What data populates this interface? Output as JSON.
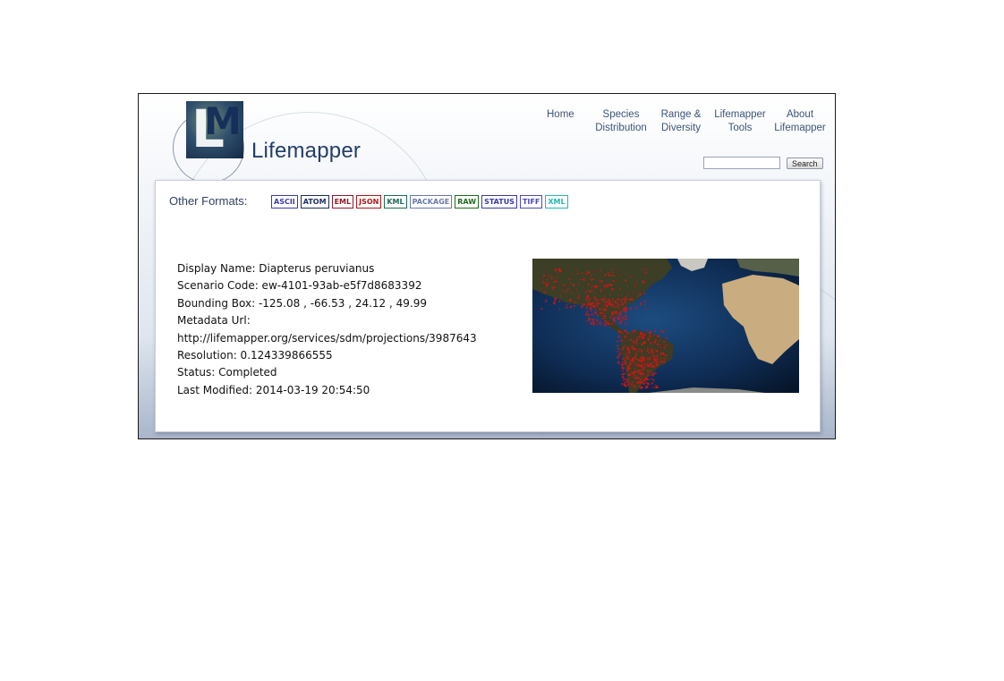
{
  "header": {
    "logo_text": "Lifemapper",
    "logo_mark": "LM",
    "nav": [
      {
        "label": "Home"
      },
      {
        "label": "Species\nDistribution"
      },
      {
        "label": "Range &\nDiversity"
      },
      {
        "label": "Lifemapper\nTools"
      },
      {
        "label": "About\nLifemapper"
      }
    ],
    "search": {
      "value": "",
      "button_label": "Search"
    }
  },
  "formats": {
    "label": "Other Formats:",
    "items": [
      {
        "label": "ASCII",
        "color": "#3a3ab0"
      },
      {
        "label": "ATOM",
        "color": "#1c2d5a"
      },
      {
        "label": "EML",
        "color": "#8a1c2a"
      },
      {
        "label": "JSON",
        "color": "#b01818"
      },
      {
        "label": "KML",
        "color": "#1f6a58"
      },
      {
        "label": "PACKAGE",
        "color": "#6a78a8"
      },
      {
        "label": "RAW",
        "color": "#1e6a1e"
      },
      {
        "label": "STATUS",
        "color": "#3a3aa8"
      },
      {
        "label": "TIFF",
        "color": "#4a4ab8"
      },
      {
        "label": "XML",
        "color": "#22b8b0"
      }
    ]
  },
  "details": {
    "display_name": "Display Name: Diapterus peruvianus",
    "scenario_code": "Scenario Code: ew-4101-93ab-e5f7d8683392",
    "bounding_box": "Bounding Box: -125.08 , -66.53 , 24.12 , 49.99",
    "metadata_label": "Metadata Url:",
    "metadata_url": "http://lifemapper.org/services/sdm/projections/3987643",
    "resolution": "Resolution: 0.124339866555",
    "status": "Status: Completed",
    "last_modified": "Last Modified: 2014-03-19 20:54:50"
  },
  "colors": {
    "nav_text": "#3d5478",
    "logo_text": "#233d6b",
    "ocean": "#0a2040",
    "land": "#cdb487",
    "occurrence": "#c81818"
  }
}
